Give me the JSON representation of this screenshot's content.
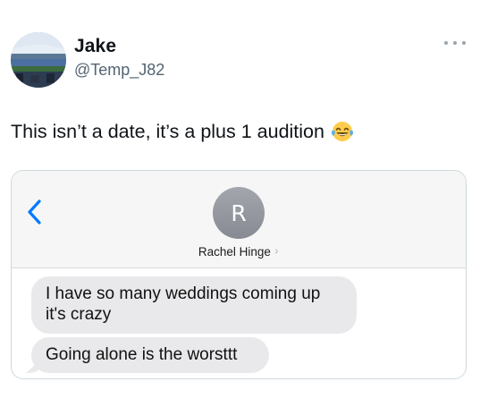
{
  "tweet": {
    "author": {
      "display_name": "Jake",
      "handle": "@Temp_J82"
    },
    "text": "This isn’t a date, it’s a plus 1 audition",
    "emoji": "face-with-tears-of-joy-icon"
  },
  "attachment": {
    "contact": {
      "initial": "R",
      "name": "Rachel Hinge",
      "chevron": "›"
    },
    "messages": [
      {
        "text": "I have so many weddings coming up it's crazy"
      },
      {
        "text": "Going alone is the worsttt"
      }
    ]
  },
  "colors": {
    "ios_blue": "#007aff",
    "bubble_gray": "#e9e9eb",
    "handle_gray": "#536471"
  }
}
